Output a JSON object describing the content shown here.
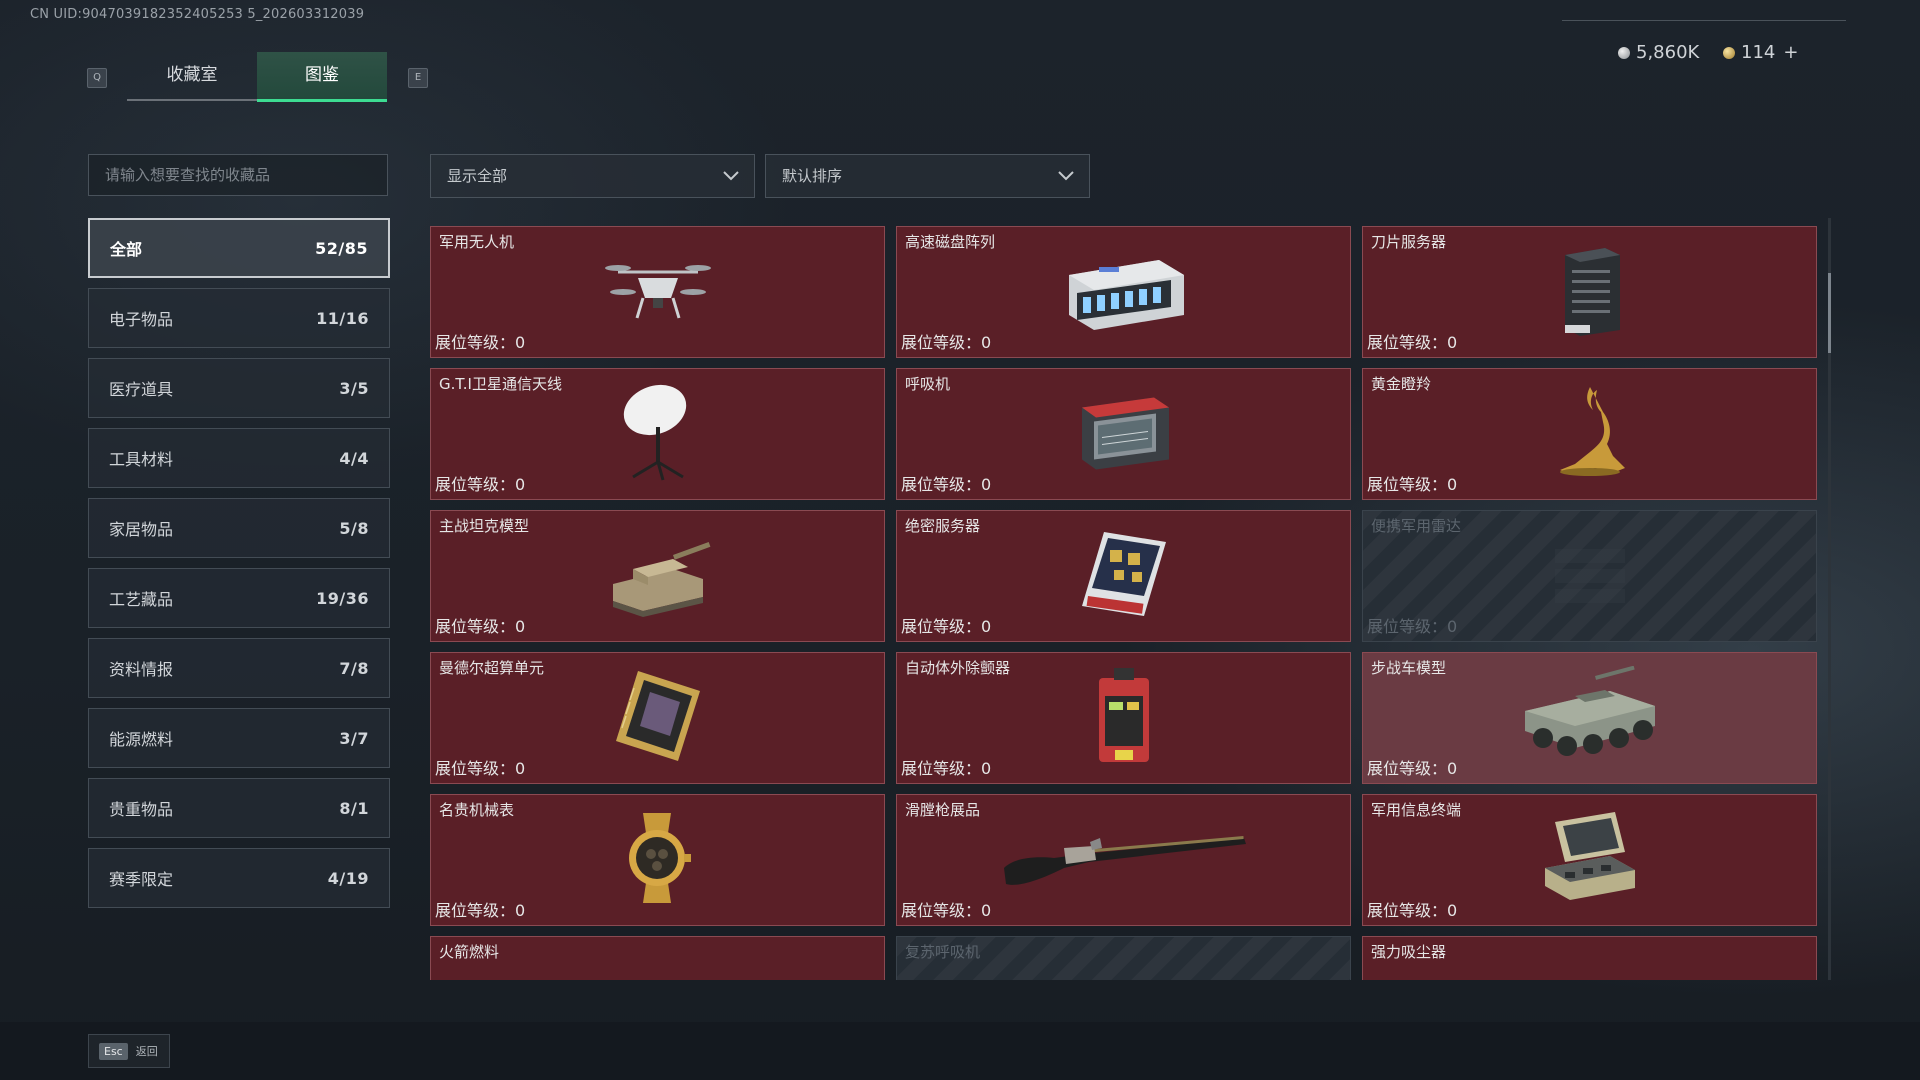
{
  "header": {
    "uid": "CN UID:9047039182352405253 5_202603312039",
    "prev_key": "Q",
    "next_key": "E",
    "tabs": [
      {
        "label": "收藏室",
        "active": false
      },
      {
        "label": "图鉴",
        "active": true
      }
    ],
    "currency_silver": "5,860K",
    "currency_gold": "114",
    "add_label": "+"
  },
  "filters": {
    "search_placeholder": "请输入想要查找的收藏品",
    "type_filter": "显示全部",
    "sort": "默认排序"
  },
  "categories": [
    {
      "label": "全部",
      "count": "52/85",
      "active": true
    },
    {
      "label": "电子物品",
      "count": "11/16"
    },
    {
      "label": "医疗道具",
      "count": "3/5"
    },
    {
      "label": "工具材料",
      "count": "4/4"
    },
    {
      "label": "家居物品",
      "count": "5/8"
    },
    {
      "label": "工艺藏品",
      "count": "19/36"
    },
    {
      "label": "资料情报",
      "count": "7/8"
    },
    {
      "label": "能源燃料",
      "count": "3/7"
    },
    {
      "label": "贵重物品",
      "count": "8/1"
    },
    {
      "label": "赛季限定",
      "count": "4/19"
    }
  ],
  "items": [
    {
      "name": "军用无人机",
      "level": "展位等级：0",
      "icon": "drone-icon",
      "locked": false
    },
    {
      "name": "高速磁盘阵列",
      "level": "展位等级：0",
      "icon": "disk-array-icon",
      "locked": false
    },
    {
      "name": "刀片服务器",
      "level": "展位等级：0",
      "icon": "blade-server-icon",
      "locked": false
    },
    {
      "name": "G.T.I卫星通信天线",
      "level": "展位等级：0",
      "icon": "satellite-dish-icon",
      "locked": false
    },
    {
      "name": "呼吸机",
      "level": "展位等级：0",
      "icon": "ventilator-icon",
      "locked": false
    },
    {
      "name": "黄金瞪羚",
      "level": "展位等级：0",
      "icon": "gold-gazelle-icon",
      "locked": false
    },
    {
      "name": "主战坦克模型",
      "level": "展位等级：0",
      "icon": "tank-icon",
      "locked": false
    },
    {
      "name": "绝密服务器",
      "level": "展位等级：0",
      "icon": "secret-server-icon",
      "locked": false
    },
    {
      "name": "便携军用雷达",
      "level": "展位等级：0",
      "icon": "radar-icon",
      "locked": true
    },
    {
      "name": "曼德尔超算单元",
      "level": "展位等级：0",
      "icon": "supercomputer-chip-icon",
      "locked": false
    },
    {
      "name": "自动体外除颤器",
      "level": "展位等级：0",
      "icon": "defibrillator-icon",
      "locked": false
    },
    {
      "name": "步战车模型",
      "level": "展位等级：0",
      "icon": "ifv-icon",
      "locked": false,
      "highlight": true
    },
    {
      "name": "名贵机械表",
      "level": "展位等级：0",
      "icon": "watch-icon",
      "locked": false
    },
    {
      "name": "滑膛枪展品",
      "level": "展位等级：0",
      "icon": "musket-icon",
      "locked": false
    },
    {
      "name": "军用信息终端",
      "level": "展位等级：0",
      "icon": "terminal-icon",
      "locked": false
    },
    {
      "name": "火箭燃料",
      "level": "",
      "icon": "fuel-can-icon",
      "locked": false
    },
    {
      "name": "复苏呼吸机",
      "level": "",
      "icon": "resuscitator-icon",
      "locked": true
    },
    {
      "name": "强力吸尘器",
      "level": "",
      "icon": "vacuum-icon",
      "locked": false
    }
  ],
  "footer": {
    "esc_key": "Esc",
    "esc_label": "返回"
  }
}
